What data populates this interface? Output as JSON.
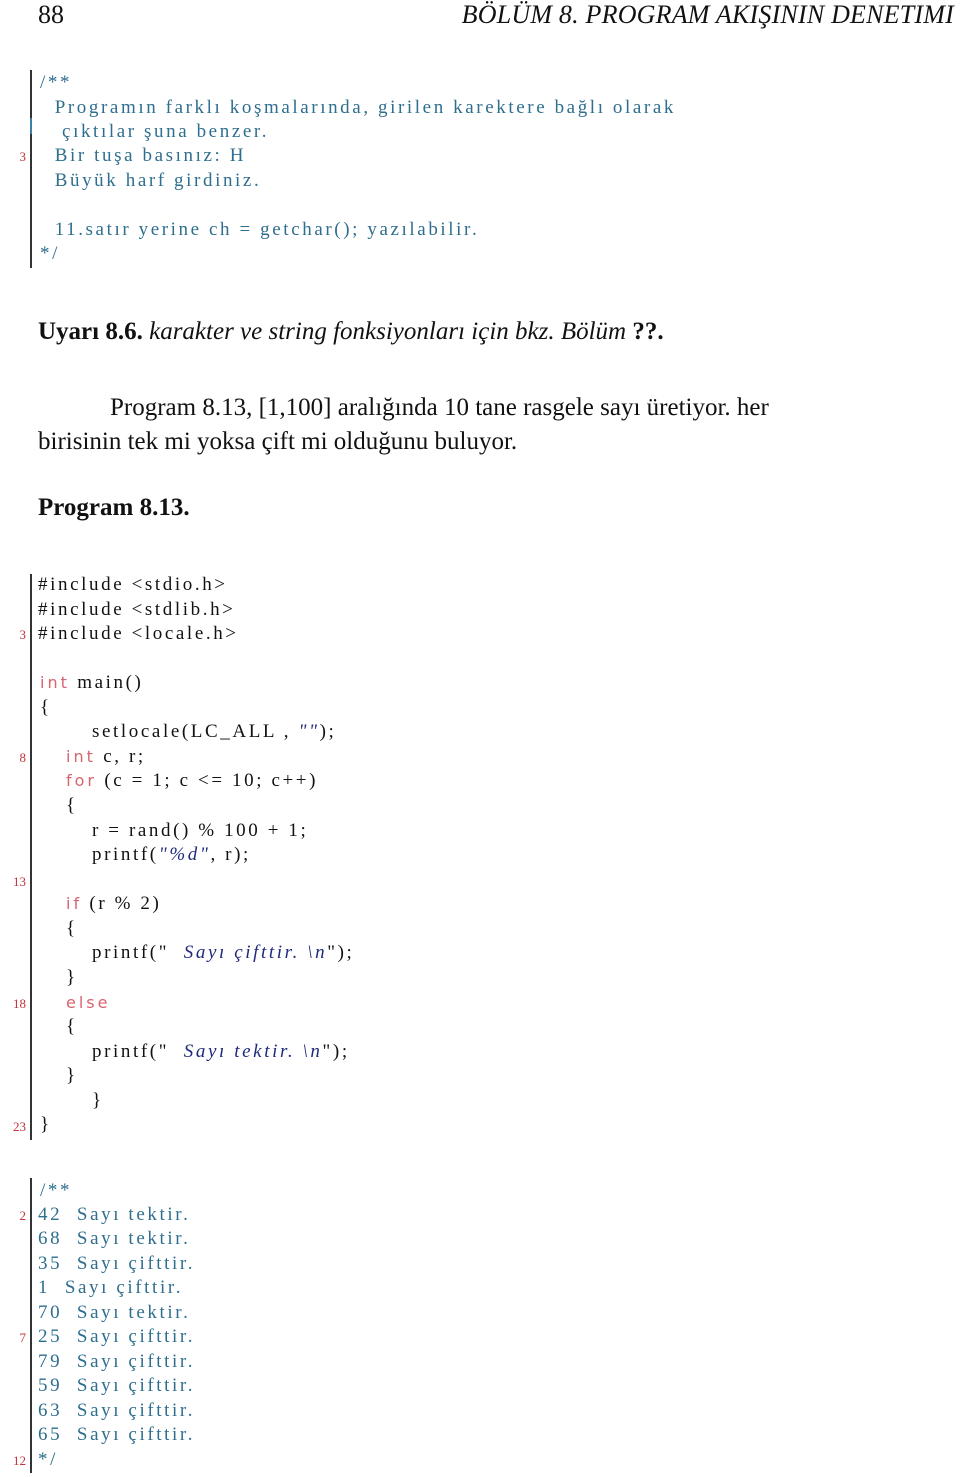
{
  "header": {
    "page_number": "88",
    "chapter_title": "BÖLÜM 8.  PROGRAM AKIŞININ DENETIMI"
  },
  "listing1": {
    "lines": [
      {
        "text": "/**",
        "num": ""
      },
      {
        "text": "  Programın farklı koşmalarında, girilen karektere bağlı olarak",
        "num": ""
      },
      {
        "text": "   çıktılar şuna benzer.",
        "num": ""
      },
      {
        "text": "  Bir tuşa basınız: H",
        "num": "3"
      },
      {
        "text": "  Büyük harf girdiniz.",
        "num": ""
      },
      {
        "text": "",
        "num": ""
      },
      {
        "text": "  11.satır yerine ch = getchar(); yazılabilir.",
        "num": ""
      },
      {
        "text": "*/",
        "num": ""
      }
    ]
  },
  "remark": {
    "label": "Uyarı 8.6.",
    "text": "karakter ve string fonksiyonları için bkz. Bölüm",
    "ref": "??."
  },
  "paragraph": {
    "line1": "Program 8.13, [1,100] aralığında 10 tane rasgele sayı üretiyor. her",
    "line2": "birisinin tek mi yoksa çift mi olduğunu buluyor."
  },
  "program_title": "Program 8.13.",
  "listing2": {
    "line_numbers": {
      "l3": "3",
      "l8": "8",
      "l13": "13",
      "l18": "18",
      "l23": "23"
    },
    "lines": {
      "inc1": "#include <stdio.h>",
      "inc2": "#include <stdlib.h>",
      "inc3": "#include <locale.h>",
      "main_kw": "int",
      "main_rest": " main()",
      "open1": "{",
      "setlocale_a": "setlocale(LC_ALL , ",
      "setlocale_str": "\"\"",
      "setlocale_b": ");",
      "decl_kw": "int",
      "decl_rest": " c, r;",
      "for_kw": "for",
      "for_rest": " (c = 1; c <= 10; c++)",
      "open2": "{",
      "rand": "r = rand() % 100 + 1;",
      "printf_a": "printf(",
      "printf_str": "\"%d\"",
      "printf_b": ", r);",
      "if_kw": "if",
      "if_rest": " (r % 2)",
      "open3": "{",
      "p1_a": "printf(\"  ",
      "p1_str": "Sayı çifttir. \\n",
      "p1_b": "\");",
      "close3": "}",
      "else_kw": "else",
      "open4": "{",
      "p2_a": "printf(\"  ",
      "p2_str": "Sayı tektir. \\n",
      "p2_b": "\");",
      "close4": "}",
      "close2": "}",
      "close1": "}"
    }
  },
  "listing3": {
    "open": "/**",
    "close": "*/",
    "line_numbers": {
      "l2": "2",
      "l7": "7",
      "l12": "12"
    },
    "outputs": [
      {
        "number": "42",
        "text": "Sayı tektir."
      },
      {
        "number": "68",
        "text": "Sayı tektir."
      },
      {
        "number": "35",
        "text": "Sayı çifttir."
      },
      {
        "number": "1",
        "text": "Sayı çifttir."
      },
      {
        "number": "70",
        "text": "Sayı tektir."
      },
      {
        "number": "25",
        "text": "Sayı çifttir."
      },
      {
        "number": "79",
        "text": "Sayı çifttir."
      },
      {
        "number": "59",
        "text": "Sayı çifttir."
      },
      {
        "number": "63",
        "text": "Sayı çifttir."
      },
      {
        "number": "65",
        "text": "Sayı çifttir."
      }
    ]
  },
  "colors": {
    "comment": "#2e6e8e",
    "keyword": "#d9636f",
    "string": "#1e2a7a",
    "line_number": "#c0333a"
  }
}
